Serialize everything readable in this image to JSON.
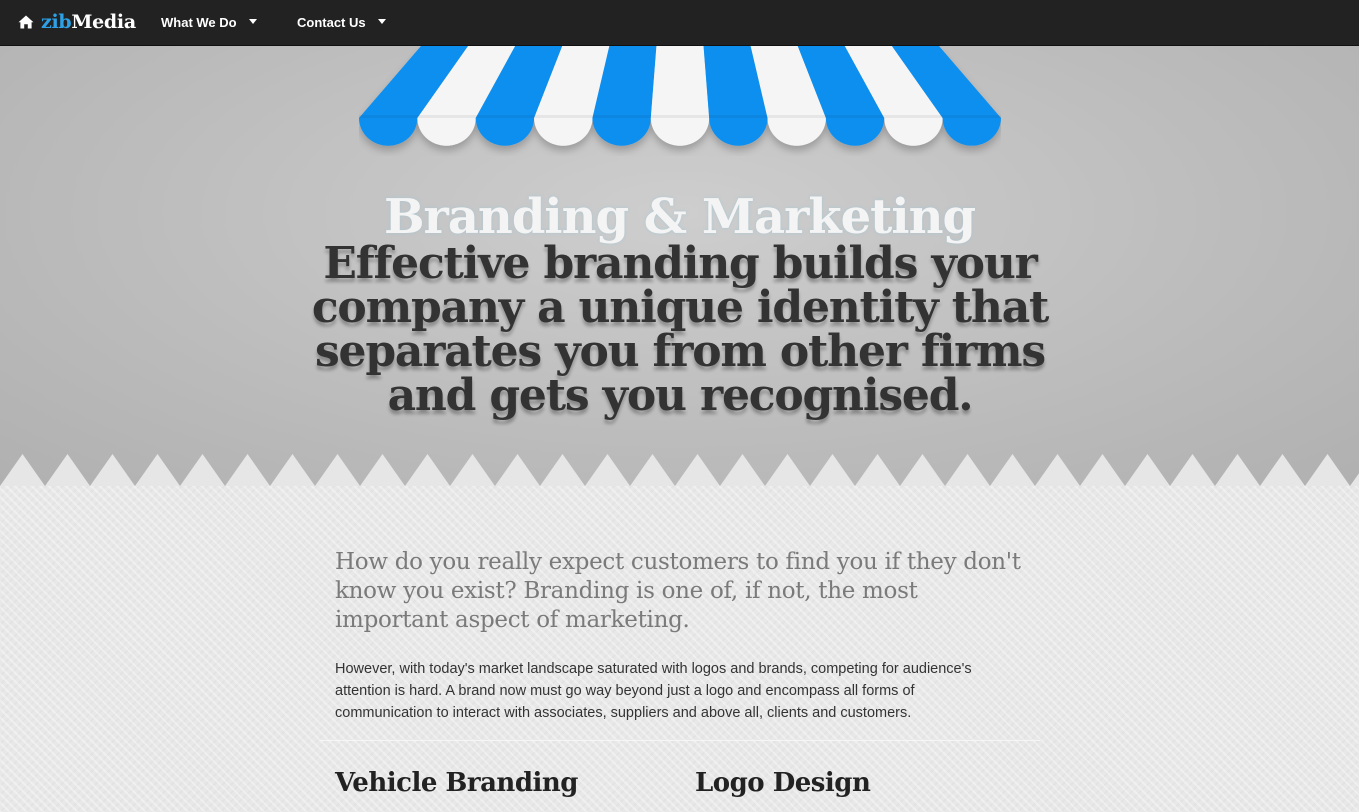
{
  "navbar": {
    "brand_prefix": "zib",
    "brand_suffix": "Media",
    "brand_icon": "home-icon",
    "items": [
      {
        "label": "What We Do",
        "icon": "caret-down-icon"
      },
      {
        "label": "Contact Us",
        "icon": "caret-down-icon"
      }
    ]
  },
  "hero": {
    "title": "Branding & Marketing",
    "tagline": "Effective branding builds your company a unique identity that separates you from other firms and gets you recognised.",
    "awning_colors": [
      "#0a8ff0",
      "#f5f5f5"
    ]
  },
  "content": {
    "lead": "How do you really expect customers to find you if they don't know you exist? Branding is one of, if not, the most important aspect of marketing.",
    "body": "However, with today's market landscape saturated with logos and brands, competing for audience's attention is hard. A brand now must go way beyond just a logo and encompass all forms of communication to interact with associates, suppliers and above all, clients and customers.",
    "columns": [
      {
        "heading": "Vehicle Branding"
      },
      {
        "heading": "Logo Design"
      }
    ]
  },
  "colors": {
    "navbar_bg": "#222222",
    "brand_accent": "#2ea1e6",
    "awning_blue": "#0a8ff0",
    "hero_bg": "#bdbdbd",
    "content_bg": "#e8e8e8"
  }
}
